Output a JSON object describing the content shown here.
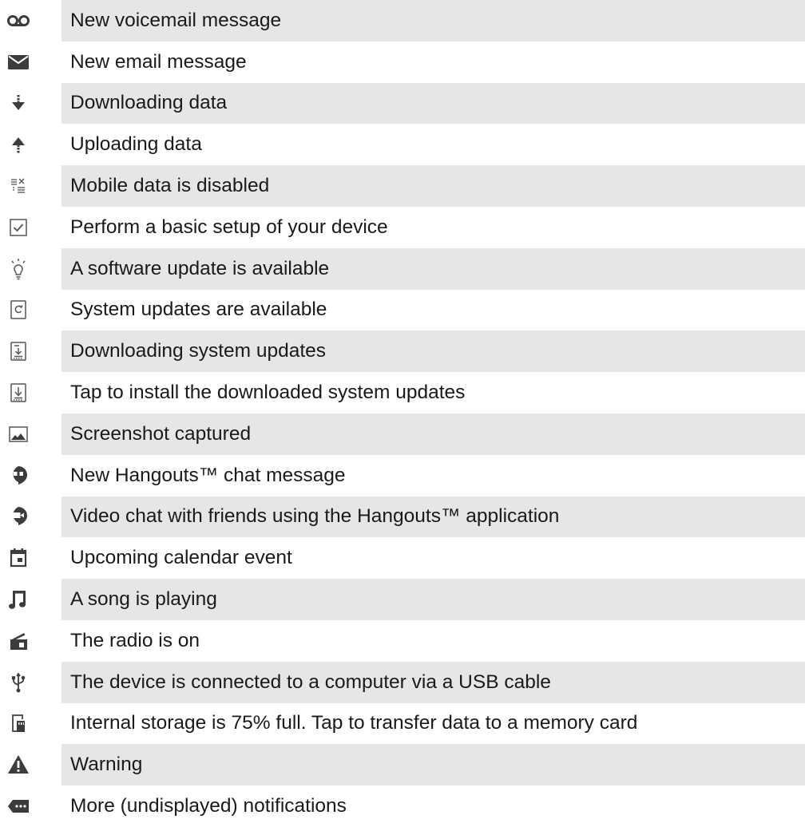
{
  "notifications": [
    {
      "icon": "voicemail-icon",
      "label": "New voicemail message"
    },
    {
      "icon": "email-icon",
      "label": "New email message"
    },
    {
      "icon": "download-data-icon",
      "label": "Downloading data"
    },
    {
      "icon": "upload-data-icon",
      "label": "Uploading data"
    },
    {
      "icon": "mobile-data-disabled-icon",
      "label": "Mobile data is disabled"
    },
    {
      "icon": "setup-checkbox-icon",
      "label": "Perform a basic setup of your device"
    },
    {
      "icon": "software-update-bulb-icon",
      "label": "A software update is available"
    },
    {
      "icon": "system-update-icon",
      "label": "System updates are available"
    },
    {
      "icon": "downloading-system-update-icon",
      "label": "Downloading system updates"
    },
    {
      "icon": "install-system-update-icon",
      "label": "Tap to install the downloaded system updates"
    },
    {
      "icon": "screenshot-icon",
      "label": "Screenshot captured"
    },
    {
      "icon": "hangouts-chat-icon",
      "label": "New Hangouts™ chat message"
    },
    {
      "icon": "hangouts-video-icon",
      "label": "Video chat with friends using the Hangouts™ application"
    },
    {
      "icon": "calendar-icon",
      "label": "Upcoming calendar event"
    },
    {
      "icon": "music-note-icon",
      "label": "A song is playing"
    },
    {
      "icon": "radio-icon",
      "label": "The radio is on"
    },
    {
      "icon": "usb-icon",
      "label": "The device is connected to a computer via a USB cable"
    },
    {
      "icon": "storage-full-icon",
      "label": "Internal storage is 75% full. Tap to transfer data to a memory card"
    },
    {
      "icon": "warning-icon",
      "label": "Warning"
    },
    {
      "icon": "more-notifications-icon",
      "label": "More (undisplayed) notifications"
    }
  ],
  "colors": {
    "row_shade": "#e6e6e6",
    "icon": "#3c3c3c",
    "text": "#1a1a1a"
  }
}
